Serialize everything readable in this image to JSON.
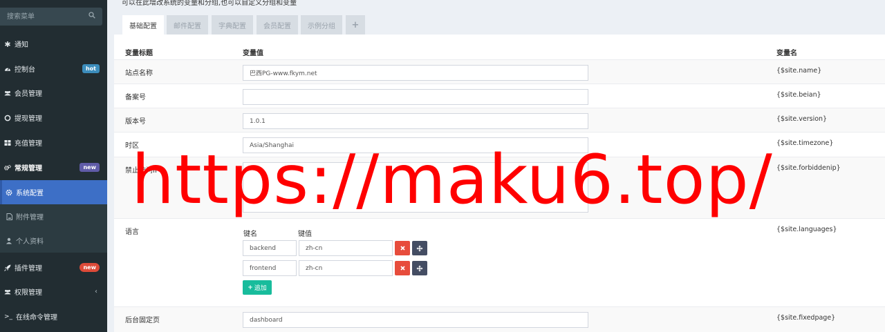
{
  "sidebar": {
    "search_placeholder": "搜索菜单",
    "items": [
      {
        "label": "通知"
      },
      {
        "label": "控制台",
        "badge": "hot"
      },
      {
        "label": "会员管理"
      },
      {
        "label": "提现管理"
      },
      {
        "label": "充值管理"
      },
      {
        "label": "常规管理",
        "badge": "new"
      },
      {
        "label": "系统配置"
      },
      {
        "label": "附件管理"
      },
      {
        "label": "个人资料"
      },
      {
        "label": "插件管理",
        "badge": "new"
      },
      {
        "label": "权限管理",
        "chevron": "‹"
      },
      {
        "label": "在线命令管理",
        "icon_text": ">_"
      }
    ]
  },
  "description": "可以在此增改系统的变量和分组,也可以自定义分组和变量",
  "tabs": [
    "基础配置",
    "邮件配置",
    "字典配置",
    "会员配置",
    "示例分组",
    "+"
  ],
  "table": {
    "headers": {
      "title": "变量标题",
      "value": "变量值",
      "name": "变量名"
    },
    "rows": [
      {
        "label": "站点名称",
        "value": "巴西PG-www.fkym.net",
        "var": "{$site.name}"
      },
      {
        "label": "备案号",
        "value": "",
        "var": "{$site.beian}"
      },
      {
        "label": "版本号",
        "value": "1.0.1",
        "var": "{$site.version}"
      },
      {
        "label": "时区",
        "value": "Asia/Shanghai",
        "var": "{$site.timezone}"
      },
      {
        "label": "禁止访问IP",
        "value": "",
        "var": "{$site.forbiddenip}"
      },
      {
        "label": "语言",
        "var": "{$site.languages}"
      },
      {
        "label": "后台固定页",
        "value": "dashboard",
        "var": "{$site.fixedpage}"
      }
    ],
    "languages": {
      "key_header": "键名",
      "value_header": "键值",
      "pairs": [
        {
          "key": "backend",
          "value": "zh-cn"
        },
        {
          "key": "frontend",
          "value": "zh-cn"
        }
      ],
      "add_label": "追加"
    }
  },
  "watermark": "https://maku6.top/",
  "colors": {
    "sidebar_bg": "#222d32",
    "active_menu": "#3d6fc6",
    "badge_hot": "#3c8dbc",
    "badge_new_purple": "#605ca8",
    "badge_new_red": "#dd4b39",
    "delete_button": "#e74c3c",
    "move_button": "#444d63",
    "add_button": "#18bc9c",
    "watermark": "#ff0000"
  }
}
